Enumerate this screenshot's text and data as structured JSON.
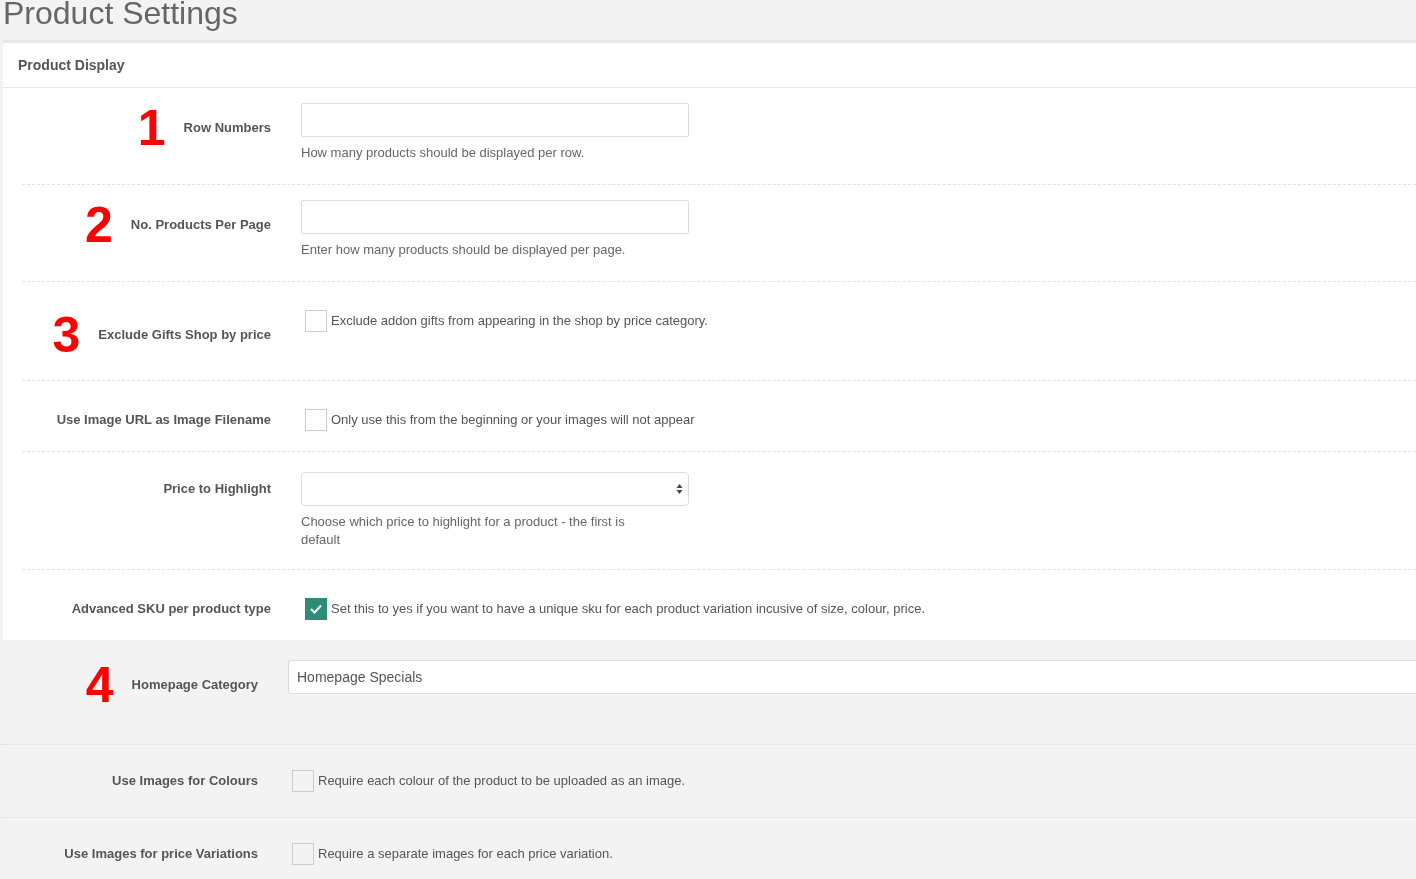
{
  "page_title": "Product Settings",
  "panel": {
    "title": "Product Display",
    "fields": [
      {
        "kind": "text",
        "annotation": "1",
        "label": "Row Numbers",
        "help": "How many products should be displayed per row."
      },
      {
        "kind": "text",
        "annotation": "2",
        "label": "No. Products Per Page",
        "help": "Enter how many products should be displayed per page."
      },
      {
        "kind": "checkbox",
        "annotation": "3",
        "label": "Exclude Gifts Shop by price",
        "checked": false,
        "help": "Exclude addon gifts from appearing in the shop by price category."
      },
      {
        "kind": "checkbox",
        "label": "Use Image URL as Image Filename",
        "checked": false,
        "help": "Only use this from the beginning or your images will not appear"
      },
      {
        "kind": "select",
        "label": "Price to Highlight",
        "help": "Choose which price to highlight for a product - the first is default"
      },
      {
        "kind": "checkbox",
        "label": "Advanced SKU per product type",
        "checked": true,
        "help": "Set this to yes if you want to have a unique sku for each product variation incusive of size, colour, price."
      }
    ]
  },
  "extra_fields": [
    {
      "kind": "text",
      "annotation": "4",
      "label": "Homepage Category",
      "value": "Homepage Specials"
    },
    {
      "kind": "checkbox",
      "label": "Use Images for Colours",
      "checked": false,
      "help": "Require each colour of the product to be uploaded as an image."
    },
    {
      "kind": "checkbox",
      "label": "Use Images for price Variations",
      "checked": false,
      "help": "Require a separate images for each price variation."
    }
  ]
}
